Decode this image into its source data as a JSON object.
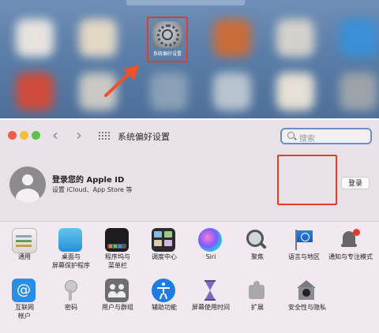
{
  "launchpad": {
    "app_label": "系统偏好设置"
  },
  "window": {
    "title": "系统偏好设置",
    "search_placeholder": "搜索"
  },
  "account": {
    "title": "登录您的 Apple ID",
    "subtitle": "设置 iCloud、App Store 等",
    "login_button": "登录"
  },
  "row1": [
    {
      "label": "通用"
    },
    {
      "label": "桌面与\n屏幕保护程序"
    },
    {
      "label": "程序坞与\n菜单栏"
    },
    {
      "label": "调度中心"
    },
    {
      "label": "Siri"
    },
    {
      "label": "聚焦"
    },
    {
      "label": "语言与地区"
    },
    {
      "label": "通知与专注模式"
    }
  ],
  "row2": [
    {
      "label": "互联网\n帐户"
    },
    {
      "label": "密码"
    },
    {
      "label": "用户与群组"
    },
    {
      "label": "辅助功能"
    },
    {
      "label": "屏幕使用时间"
    },
    {
      "label": "扩展"
    },
    {
      "label": "安全性与隐私"
    }
  ],
  "colors": {
    "highlight": "#e53b2c",
    "search_border": "#6a8fc7"
  }
}
